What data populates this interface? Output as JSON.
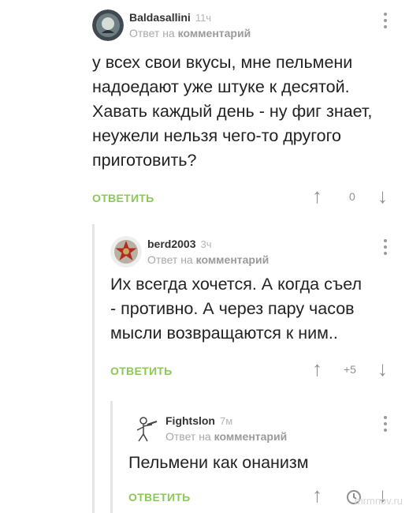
{
  "comments": [
    {
      "author": "Baldasallini",
      "time": "11ч",
      "reply_prefix": "Ответ на",
      "reply_target": "комментарий",
      "text": "у всех свои вкусы, мне пельмени\nнадоедают уже штуке к десятой.\nХавать каждый день - ну фиг знает,\nнеужели нельзя чего-то другого\nприготовить?",
      "reply_label": "ОТВЕТИТЬ",
      "rating": "0",
      "avatar_icon": "emblem-avatar-icon"
    },
    {
      "author": "berd2003",
      "time": "3ч",
      "reply_prefix": "Ответ на",
      "reply_target": "комментарий",
      "text": "Их всегда хочется. А когда съел\n- противно. А через пару часов\nмысли возвращаются к ним..",
      "reply_label": "ОТВЕТИТЬ",
      "rating": "+5",
      "avatar_icon": "red-star-order-icon"
    },
    {
      "author": "Fightslon",
      "time": "7м",
      "reply_prefix": "Ответ на",
      "reply_target": "комментарий",
      "text": "Пельмени как онанизм",
      "reply_label": "ОТВЕТИТЬ",
      "rating": "",
      "avatar_icon": "soldier-sketch-icon"
    }
  ],
  "watermark": "mrmnov.ru",
  "colors": {
    "accent": "#8ac858",
    "muted": "#a8a8a8",
    "arrow": "#8f8f8f",
    "thread": "#e5e5e5"
  },
  "icons": {
    "up": "↑",
    "down": "↓",
    "menu": "kebab-menu-icon",
    "timer": "clock-icon"
  }
}
